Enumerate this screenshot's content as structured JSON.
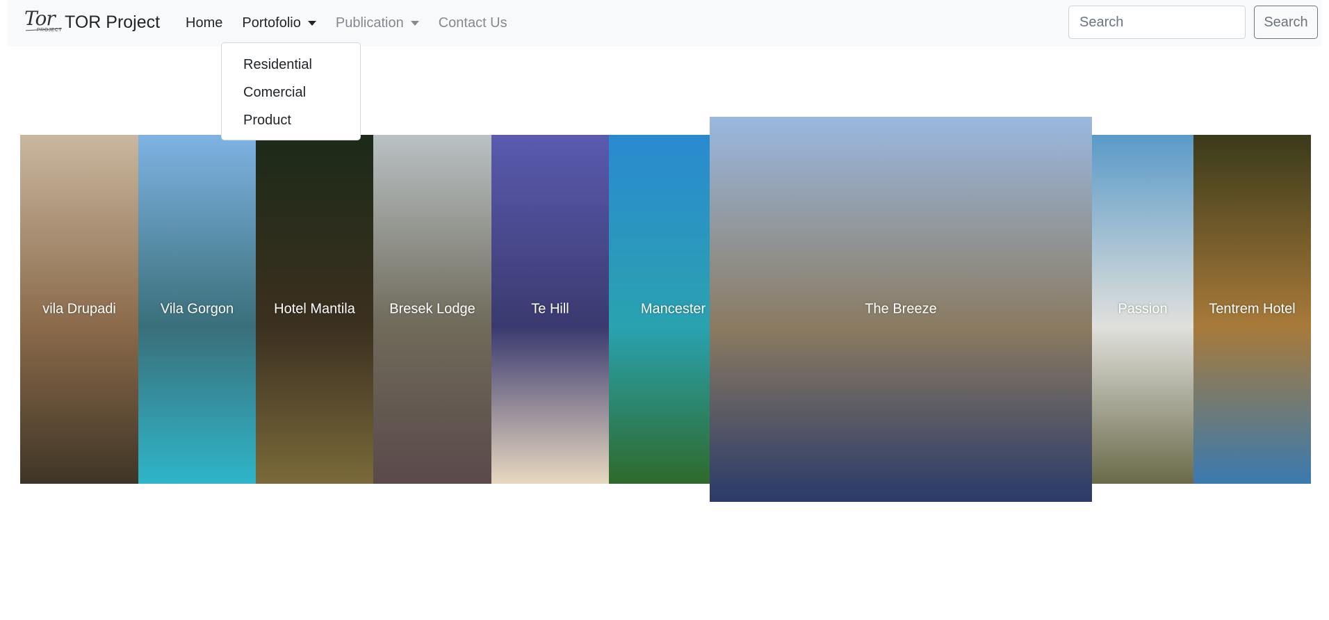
{
  "brand": {
    "logo_text": "Tor",
    "logo_subtext": "PROJECT",
    "name": "TOR Project"
  },
  "nav": {
    "home": "Home",
    "portfolio": "Portofolio",
    "publication": "Publication",
    "contact": "Contact Us"
  },
  "dropdown": {
    "items": [
      "Residential",
      "Comercial",
      "Product"
    ]
  },
  "search": {
    "placeholder": "Search",
    "button": "Search"
  },
  "gallery": {
    "panels": [
      {
        "label": "vila Drupadi",
        "top": "#c9b79f",
        "mid": "#8a6a4a",
        "bottom": "#3f3526"
      },
      {
        "label": "Vila Gorgon",
        "top": "#7fb3e3",
        "mid": "#3a6f7a",
        "bottom": "#2fb5c9"
      },
      {
        "label": "Hotel Mantila",
        "top": "#1c2a18",
        "mid": "#3c3020",
        "bottom": "#7a6a3a"
      },
      {
        "label": "Bresek Lodge",
        "top": "#b9c1c4",
        "mid": "#6f6a5a",
        "bottom": "#5a4a4a"
      },
      {
        "label": "Te Hill",
        "top": "#5a5ab0",
        "mid": "#3a3a70",
        "bottom": "#e8d8c0"
      },
      {
        "label": "Mancester",
        "top": "#2a8ad0",
        "mid": "#2aa2b0",
        "bottom": "#2e6a2a"
      },
      {
        "label": "The Breeze",
        "top": "#9ab8e0",
        "mid": "#8a7a60",
        "bottom": "#2a3a6a"
      },
      {
        "label": "Passion",
        "top": "#5a9ac8",
        "mid": "#e0e0dc",
        "bottom": "#6a6a4a"
      },
      {
        "label": "Tentrem Hotel",
        "top": "#3a3a1a",
        "mid": "#a87a3a",
        "bottom": "#3a7ab0"
      }
    ]
  }
}
